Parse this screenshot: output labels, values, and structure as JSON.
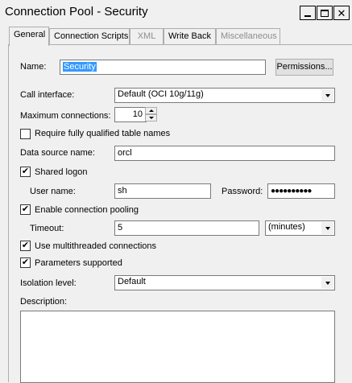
{
  "window": {
    "title": "Connection Pool - Security"
  },
  "tabs": [
    {
      "label": "General",
      "state": "active"
    },
    {
      "label": "Connection Scripts",
      "state": "normal"
    },
    {
      "label": "XML",
      "state": "disabled"
    },
    {
      "label": "Write Back",
      "state": "normal"
    },
    {
      "label": "Miscellaneous",
      "state": "disabled"
    }
  ],
  "form": {
    "name_label": "Name:",
    "name_value": "Security",
    "permissions_button": "Permissions...",
    "call_interface_label": "Call interface:",
    "call_interface_value": "Default (OCI 10g/11g)",
    "max_connections_label": "Maximum connections:",
    "max_connections_value": "10",
    "require_qualified_label": "Require fully qualified table names",
    "require_qualified_checked": false,
    "dsn_label": "Data source name:",
    "dsn_value": "orcl",
    "shared_logon_label": "Shared logon",
    "shared_logon_checked": true,
    "user_name_label": "User name:",
    "user_name_value": "sh",
    "password_label": "Password:",
    "password_value": "●●●●●●●●●●",
    "enable_pooling_label": "Enable connection pooling",
    "enable_pooling_checked": true,
    "timeout_label": "Timeout:",
    "timeout_value": "5",
    "timeout_unit": "(minutes)",
    "multithreaded_label": "Use multithreaded connections",
    "multithreaded_checked": true,
    "params_supported_label": "Parameters supported",
    "params_supported_checked": true,
    "isolation_label": "Isolation level:",
    "isolation_value": "Default",
    "description_label": "Description:",
    "description_value": ""
  },
  "icons": {
    "checkmark": "✔",
    "close": "✕"
  }
}
